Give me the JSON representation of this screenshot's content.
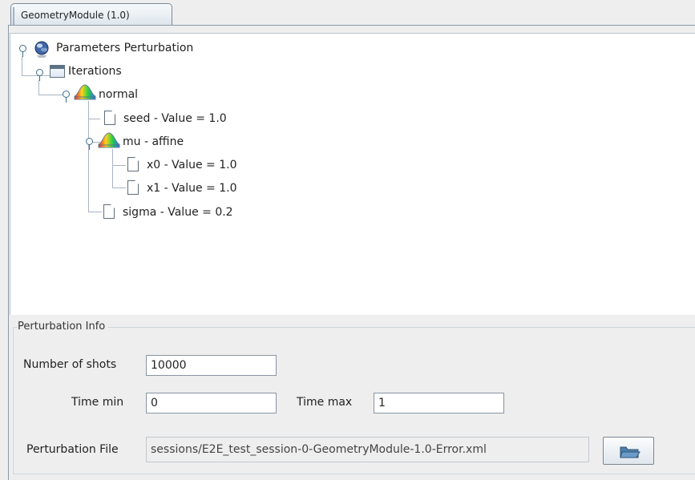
{
  "tab": {
    "label": "GeometryModule (1.0)"
  },
  "tree": {
    "root": "Parameters Perturbation",
    "iterations": "Iterations",
    "normal": "normal",
    "seed": "seed - Value = 1.0",
    "mu": "mu - affine",
    "x0": "x0 - Value = 1.0",
    "x1": "x1 - Value = 1.0",
    "sigma": "sigma - Value = 0.2"
  },
  "perturbation_info": {
    "title": "Perturbation Info",
    "number_of_shots_label": "Number of shots",
    "number_of_shots_value": "10000",
    "time_min_label": "Time min",
    "time_min_value": "0",
    "time_max_label": "Time max",
    "time_max_value": "1",
    "file_label": "Perturbation File",
    "file_value": "sessions/E2E_test_session-0-GeometryModule-1.0-Error.xml"
  },
  "icons": {
    "root": "globe-icon",
    "folder": "folder-icon",
    "distribution": "distribution-icon",
    "document": "document-icon",
    "browse": "open-folder-icon"
  },
  "colors": {
    "tree_background": "#ffffff",
    "panel_background": "#eeeeee",
    "distribution_gradient": "#ff9a1a"
  }
}
